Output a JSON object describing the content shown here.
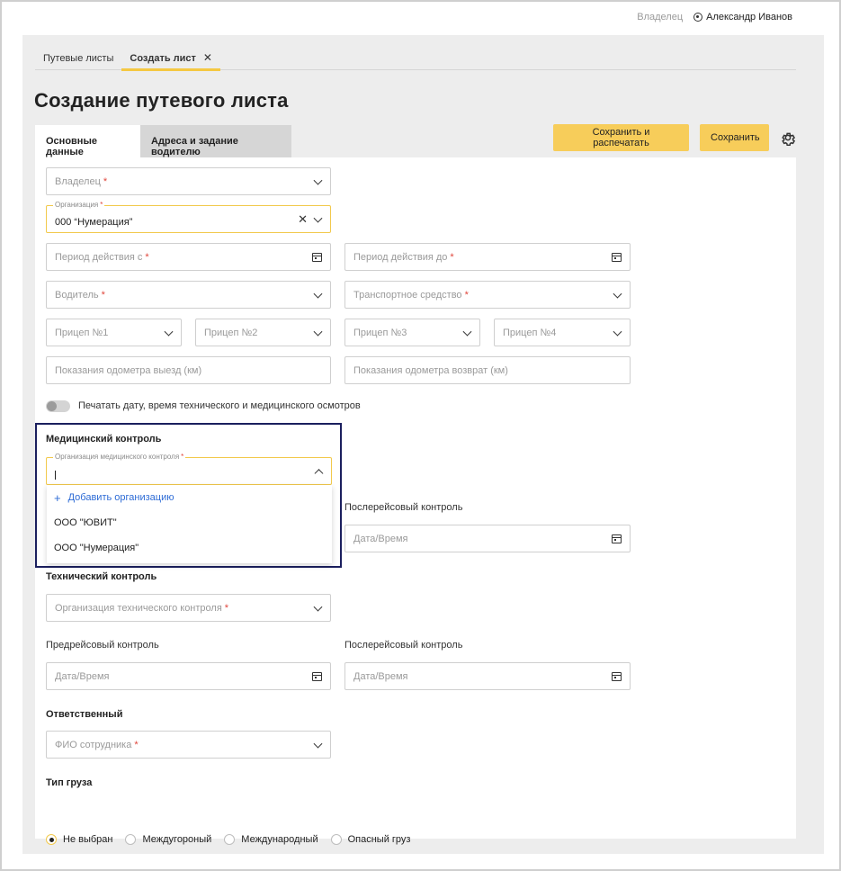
{
  "header": {
    "role": "Владелец",
    "user_name": "Александр Иванов"
  },
  "top_tabs": [
    {
      "label": "Путевые листы"
    },
    {
      "label": "Создать лист"
    }
  ],
  "page_title": "Создание путевого листа",
  "section_tabs": [
    {
      "label": "Основные данные"
    },
    {
      "label": "Адреса и задание водителю"
    }
  ],
  "actions": {
    "save_print": "Сохранить и распечатать",
    "save": "Сохранить"
  },
  "form": {
    "owner": "Владелец",
    "organization_label": "Организация",
    "organization_value": "000 “Нумерация”",
    "period_from": "Период действия с",
    "period_to": "Период действия до",
    "driver": "Водитель",
    "vehicle": "Транспортное средство",
    "trailer1": "Прицеп №1",
    "trailer2": "Прицеп №2",
    "trailer3": "Прицеп №3",
    "trailer4": "Прицеп №4",
    "odometer_out": "Показания одометра выезд (км)",
    "odometer_return": "Показания одометра возврат (км)",
    "print_toggle": "Печатать дату, время технического и медицинского осмотров"
  },
  "medical": {
    "title": "Медицинский контроль",
    "org_label": "Организация медицинского контроля",
    "post_trip_label": "Послерейсовый контроль",
    "post_trip_placeholder": "Дата/Время",
    "dropdown": {
      "add": "Добавить организацию",
      "options": [
        "ООО \"ЮВИТ\"",
        "ООО \"Нумерация\""
      ]
    }
  },
  "technical": {
    "title": "Технический контроль",
    "org_placeholder": "Организация технического контроля",
    "pre_trip_label": "Предрейсовый контроль",
    "pre_trip_placeholder": "Дата/Время",
    "post_trip_label": "Послерейсовый контроль",
    "post_trip_placeholder": "Дата/Время"
  },
  "responsible": {
    "title": "Ответственный",
    "placeholder": "ФИО сотрудника"
  },
  "cargo": {
    "title": "Тип груза",
    "options": [
      "Не выбран",
      "Междугороный",
      "Международный",
      "Опасный груз"
    ]
  },
  "required_mark": "*",
  "colors": {
    "accent": "#f7cd5a",
    "highlight_border": "#1b1f5e",
    "link": "#2d6bd6",
    "required": "#e0463c"
  }
}
